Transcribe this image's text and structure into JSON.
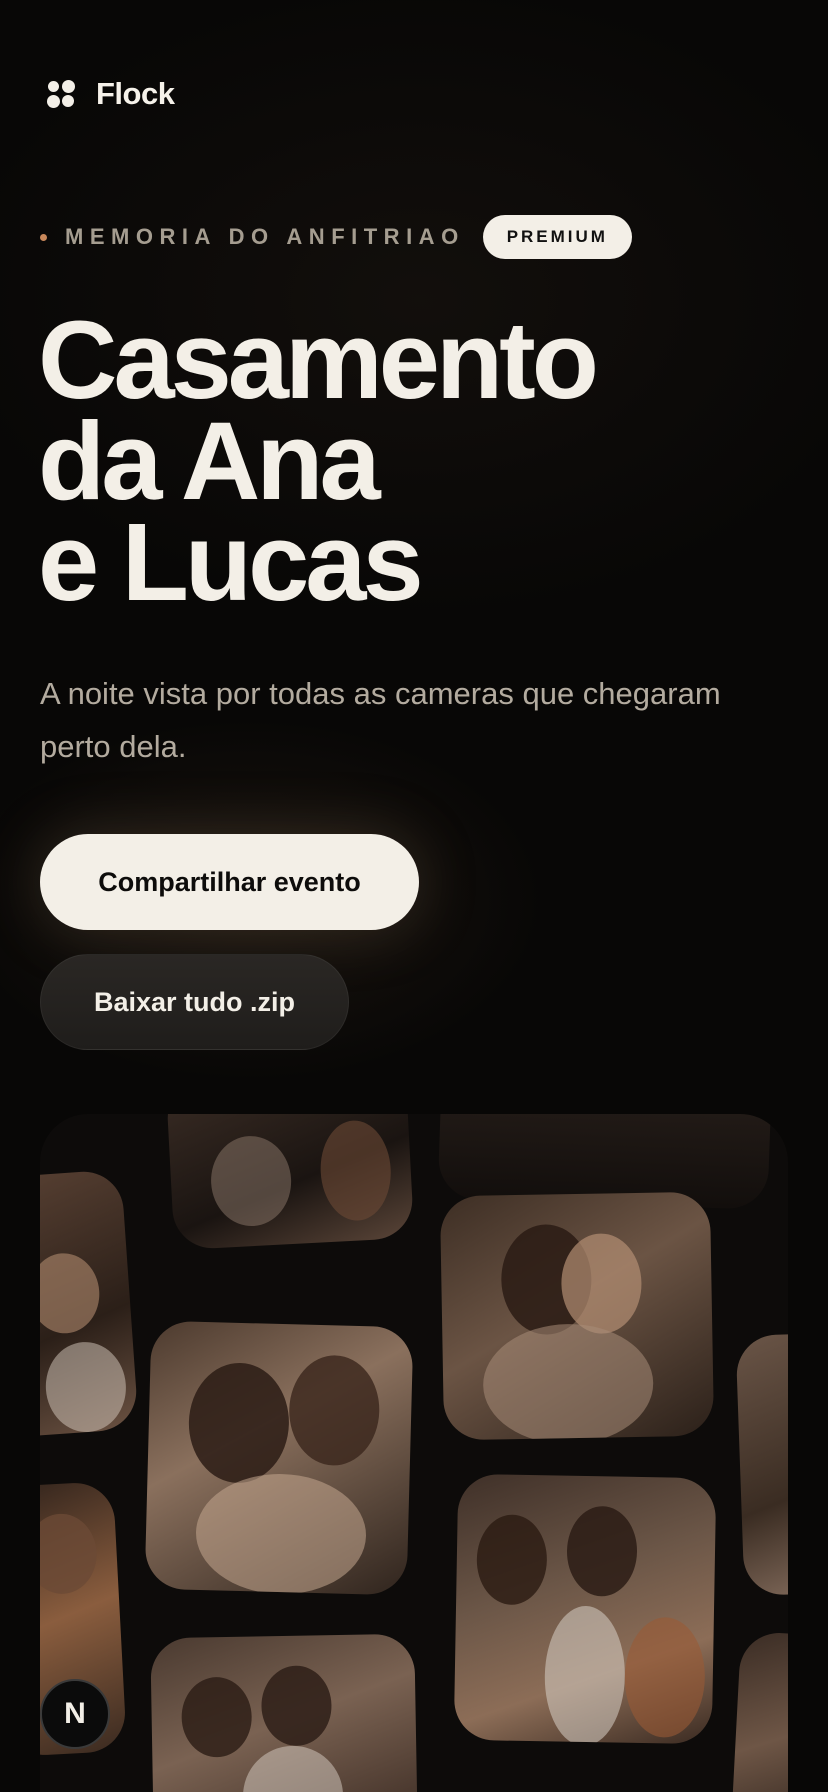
{
  "brand": {
    "name": "Flock",
    "icon": "flock-logo-icon"
  },
  "hero": {
    "eyebrow": "MEMORIA DO ANFITRIAO",
    "badge": "PREMIUM",
    "title_lines": [
      "Casamento",
      "da Ana",
      "e Lucas"
    ],
    "subtitle": "A noite vista por todas as cameras que chegaram perto dela."
  },
  "actions": {
    "share_label": "Compartilhar evento",
    "download_label": "Baixar tudo .zip"
  },
  "floating": {
    "badge_letter": "N"
  },
  "colors": {
    "background": "#080706",
    "text": "#f3efe7",
    "muted": "#a59d90",
    "accent_dot": "#c8875a",
    "button_light": "#f3efe7",
    "button_dark": "#252220"
  }
}
